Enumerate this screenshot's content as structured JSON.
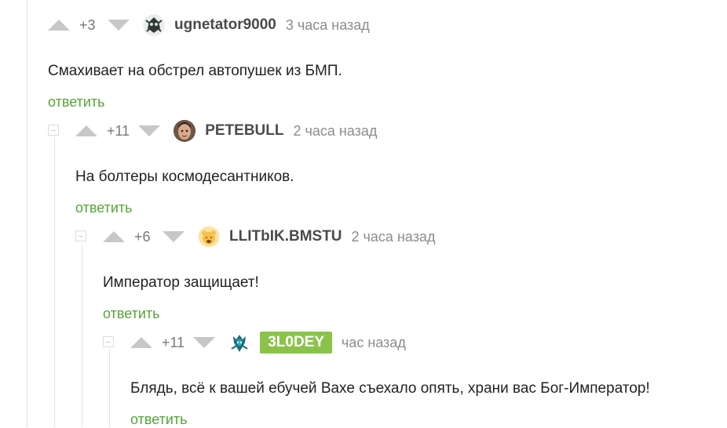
{
  "comments": [
    {
      "rating": "+3",
      "username": "ugnetator9000",
      "avatar": "skull-avatar-icon",
      "time": "3 часа назад",
      "text": "Смахивает на обстрел автопушек из БМП.",
      "reply": "ответить"
    },
    {
      "rating": "+11",
      "username": "PETEBULL",
      "avatar": "face-avatar-icon",
      "time": "2 часа назад",
      "text": "На болтеры космодесантников.",
      "reply": "ответить"
    },
    {
      "rating": "+6",
      "username": "LLITbIK.BMSTU",
      "avatar": "emoji-avatar-icon",
      "time": "2 часа назад",
      "text": "Император защищает!",
      "reply": "ответить"
    },
    {
      "rating": "+11",
      "username": "3L0DEY",
      "avatar": "warhammer-avatar-icon",
      "time": "час назад",
      "text": "Блядь, всё к вашей ебучей Вахе съехало опять, храни вас Бог-Император!",
      "reply": "ответить"
    }
  ],
  "colors": {
    "reply_link": "#58a23b",
    "badge": "#8bc34a",
    "arrow": "#c7c7c7"
  }
}
